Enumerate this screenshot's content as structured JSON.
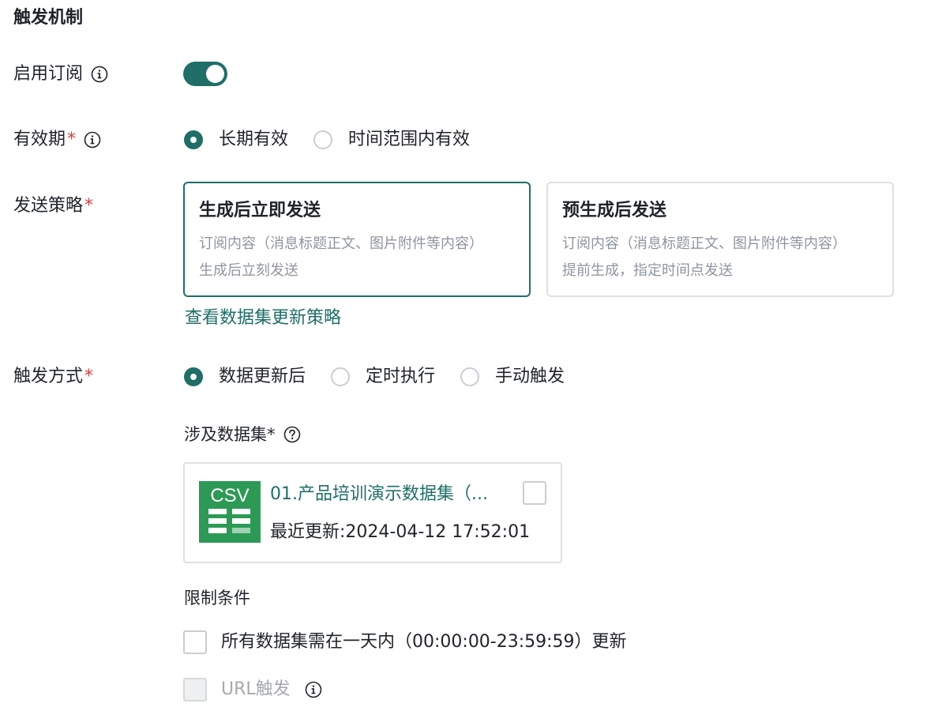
{
  "section": {
    "title": "触发机制"
  },
  "subscription": {
    "label": "启用订阅",
    "enabled": true
  },
  "validity": {
    "label": "有效期",
    "required_mark": "*",
    "options": [
      {
        "label": "长期有效",
        "checked": true
      },
      {
        "label": "时间范围内有效",
        "checked": false
      }
    ]
  },
  "strategy": {
    "label": "发送策略",
    "required_mark": "*",
    "cards": [
      {
        "title": "生成后立即发送",
        "desc_line1": "订阅内容（消息标题正文、图片附件等内容）",
        "desc_line2": "生成后立刻发送",
        "selected": true
      },
      {
        "title": "预生成后发送",
        "desc_line1": "订阅内容（消息标题正文、图片附件等内容）",
        "desc_line2": "提前生成，指定时间点发送",
        "selected": false
      }
    ],
    "link": "查看数据集更新策略"
  },
  "trigger": {
    "label": "触发方式",
    "required_mark": "*",
    "options": [
      {
        "label": "数据更新后",
        "checked": true
      },
      {
        "label": "定时执行",
        "checked": false
      },
      {
        "label": "手动触发",
        "checked": false
      }
    ]
  },
  "datasets": {
    "label": "涉及数据集*",
    "items": [
      {
        "icon_text": "CSV",
        "name": "01.产品培训演示数据集（...",
        "updated": "最近更新:2024-04-12 17:52:01",
        "checked": false
      }
    ]
  },
  "conditions": {
    "label": "限制条件",
    "options": [
      {
        "label": "所有数据集需在一天内（00:00:00-23:59:59）更新",
        "checked": false,
        "disabled": false
      },
      {
        "label": "URL触发",
        "checked": false,
        "disabled": true
      }
    ]
  },
  "colors": {
    "accent": "#1f6e68",
    "required": "#e03a3a",
    "csv_green": "#2c9a55"
  }
}
